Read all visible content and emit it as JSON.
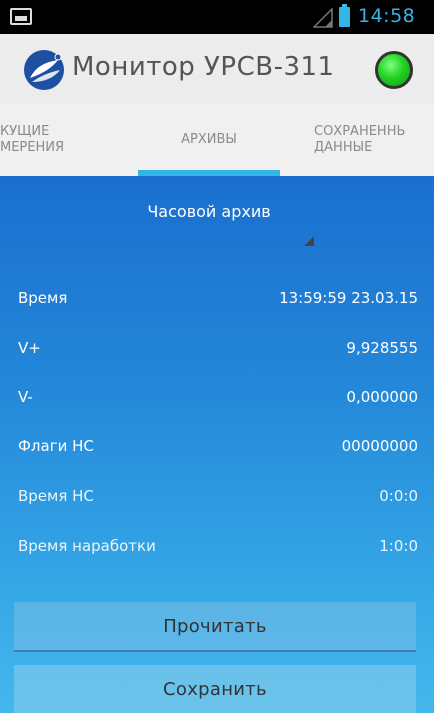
{
  "status_bar": {
    "time": "14:58",
    "icons": [
      "app-notification-icon",
      "signal-icon",
      "battery-icon"
    ],
    "accent_color": "#33b5e5"
  },
  "action_bar": {
    "title": "Монитор УРСВ-311",
    "logo_icon": "app-logo-icon",
    "status_indicator_color": "#22d322"
  },
  "tabs": [
    {
      "label": "ТЕКУЩИЕ\nИЗМЕРЕНИЯ",
      "visible_text": "КУЩИЕ\nМЕРЕНИЯ",
      "selected": false
    },
    {
      "label": "АРХИВЫ",
      "selected": true
    },
    {
      "label": "СОХРАНЕННЫЕ\nДАННЫЕ",
      "visible_text": "СОХРАНЕННЬ\nДАННЫЕ",
      "selected": false
    }
  ],
  "archive_selector": {
    "selected": "Часовой архив"
  },
  "rows": [
    {
      "label": "Время",
      "value": "13:59:59 23.03.15"
    },
    {
      "label": "V+",
      "value": "9,928555"
    },
    {
      "label": "V-",
      "value": "0,000000"
    },
    {
      "label": "Флаги НС",
      "value": "00000000"
    },
    {
      "label": "Время НС",
      "value": "0:0:0"
    },
    {
      "label": "Время наработки",
      "value": "1:0:0"
    }
  ],
  "buttons": {
    "read": "Прочитать",
    "save": "Сохранить"
  },
  "colors": {
    "tab_indicator": "#33b5e5",
    "content_gradient_top": "#1a6fcf",
    "content_gradient_bottom": "#44b8ec"
  }
}
